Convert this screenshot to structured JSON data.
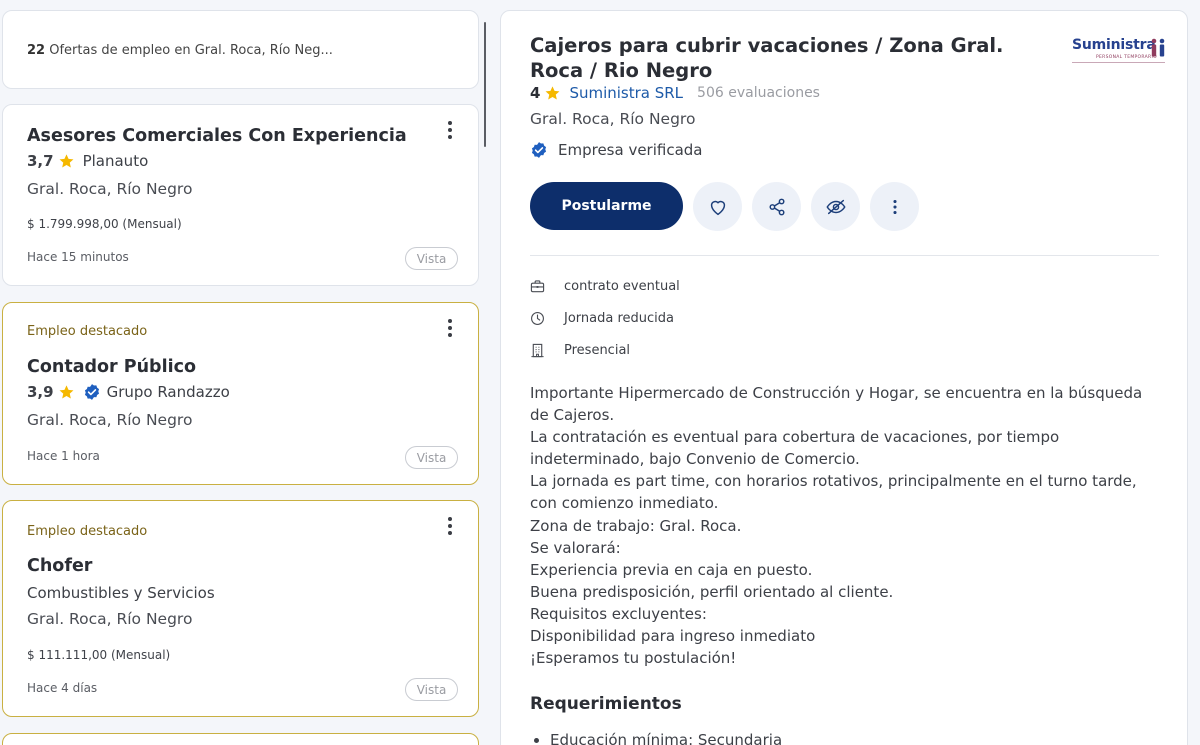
{
  "results": {
    "count": "22",
    "text": "Ofertas de empleo en Gral. Roca, Río Neg..."
  },
  "jobs": [
    {
      "title": "Asesores Comerciales Con Experiencia",
      "rating": "3,7",
      "company": "Planauto",
      "location": "Gral. Roca, Río Negro",
      "salary": "$ 1.799.998,00 (Mensual)",
      "time": "Hace 15 minutos",
      "view_label": "Vista"
    },
    {
      "featured_label": "Empleo destacado",
      "title": "Contador Público",
      "rating": "3,9",
      "company": "Grupo Randazzo",
      "location": "Gral. Roca, Río Negro",
      "time": "Hace 1 hora",
      "view_label": "Vista"
    },
    {
      "featured_label": "Empleo destacado",
      "title": "Chofer",
      "company": "Combustibles y Servicios",
      "location": "Gral. Roca, Río Negro",
      "salary": "$ 111.111,00 (Mensual)",
      "time": "Hace 4 días",
      "view_label": "Vista"
    }
  ],
  "detail": {
    "title": "Cajeros para cubrir vacaciones / Zona Gral. Roca / Rio Negro",
    "logo": {
      "text": "Suministra",
      "subtext": "PERSONAL TEMPORARIO"
    },
    "rating": "4",
    "company": "Suministra SRL",
    "evaluations": "506 evaluaciones",
    "location": "Gral. Roca, Río Negro",
    "verified_label": "Empresa verificada",
    "apply_label": "Postularme",
    "features": [
      {
        "icon": "briefcase-icon",
        "label": "contrato eventual"
      },
      {
        "icon": "clock-icon",
        "label": "Jornada reducida"
      },
      {
        "icon": "building-icon",
        "label": "Presencial"
      }
    ],
    "description": [
      "Importante Hipermercado de Construcción y Hogar, se encuentra en la búsqueda de Cajeros.",
      "La contratación es eventual para cobertura de vacaciones, por tiempo indeterminado, bajo Convenio de Comercio.",
      "La jornada es part time, con horarios rotativos, principalmente en el turno tarde, con comienzo inmediato.",
      "Zona de trabajo: Gral. Roca.",
      "Se valorará:",
      "Experiencia previa en caja en puesto.",
      "Buena predisposición, perfil orientado al cliente.",
      "Requisitos excluyentes:",
      "Disponibilidad para ingreso inmediato",
      "¡Esperamos tu postulación!"
    ],
    "requirements_title": "Requerimientos",
    "requirements": [
      "Educación mínima: Secundaria"
    ]
  },
  "colors": {
    "primary": "#0d2e6b",
    "link": "#1d5aa8",
    "star": "#f5b800",
    "featured_border": "#c9b042",
    "verified": "#1f5fbf"
  }
}
